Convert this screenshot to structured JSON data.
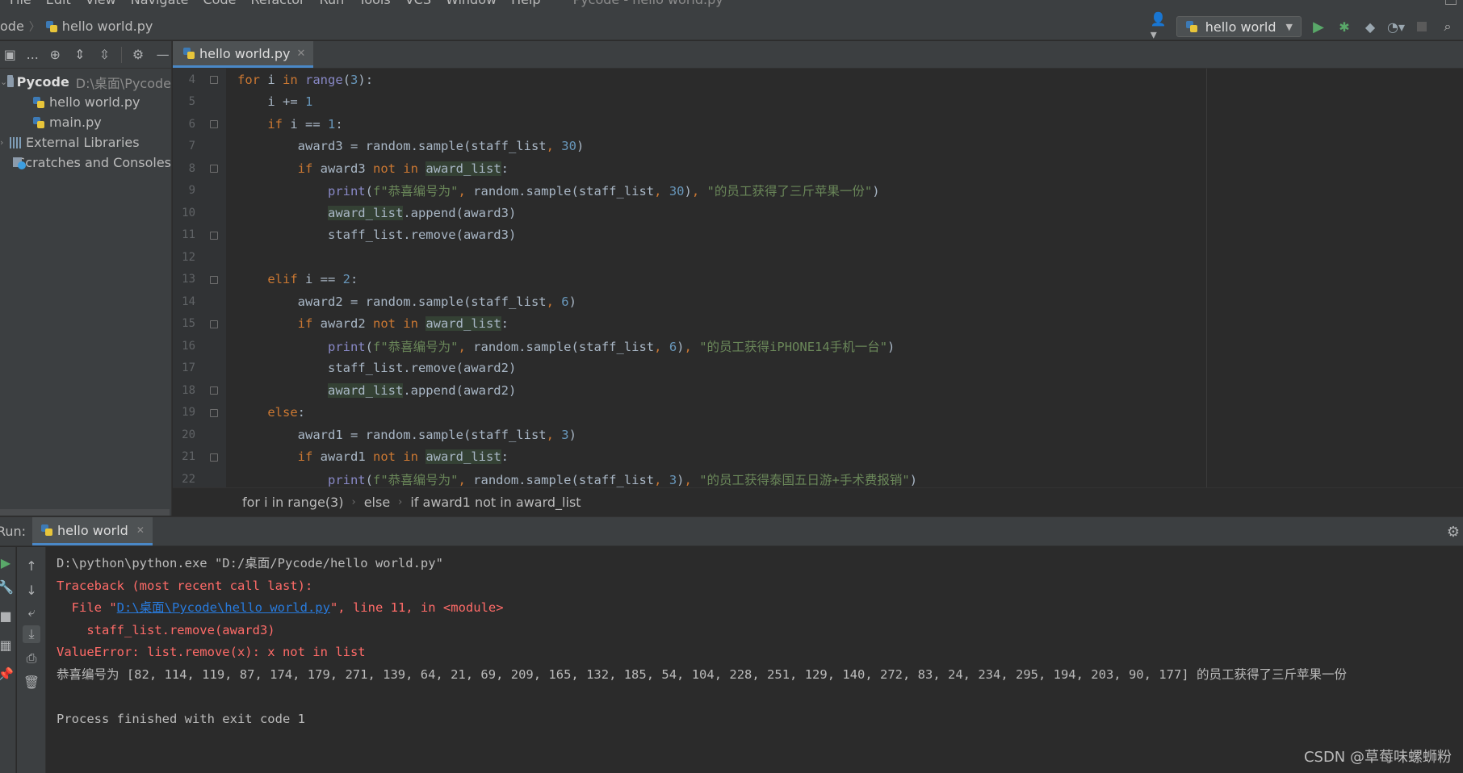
{
  "menubar": {
    "items": [
      "File",
      "Edit",
      "View",
      "Navigate",
      "Code",
      "Refactor",
      "Run",
      "Tools",
      "VCS",
      "Window",
      "Help"
    ],
    "title": "Pycode - hello world.py"
  },
  "navbar": {
    "crumbs": [
      "ode",
      "hello world.py"
    ],
    "run_config": "hello world"
  },
  "project": {
    "toolbar_label": "...",
    "root_name": "Pycode",
    "root_path": "D:\\桌面\\Pycode",
    "files": [
      "hello world.py",
      "main.py"
    ],
    "external_libraries": "External Libraries",
    "scratches": "Scratches and Consoles"
  },
  "editor": {
    "tab_label": "hello world.py",
    "line_numbers": [
      "4",
      "5",
      "6",
      "7",
      "8",
      "9",
      "10",
      "11",
      "12",
      "13",
      "14",
      "15",
      "16",
      "17",
      "18",
      "19",
      "20",
      "21",
      "22"
    ],
    "breadcrumb": [
      "for i in range(3)",
      "else",
      "if award1 not in award_list"
    ]
  },
  "run": {
    "label": "Run:",
    "tab_label": "hello world",
    "console": {
      "cmd": "D:\\python\\python.exe \"D:/桌面/Pycode/hello world.py\"",
      "traceback": "Traceback (most recent call last):",
      "file_prefix": "  File \"",
      "file_link": "D:\\桌面\\Pycode\\hello world.py",
      "file_suffix": "\", line 11, in <module>",
      "code_line": "    staff_list.remove(award3)",
      "error": "ValueError: list.remove(x): x not in list",
      "output": "恭喜编号为 [82, 114, 119, 87, 174, 179, 271, 139, 64, 21, 69, 209, 165, 132, 185, 54, 104, 228, 251, 129, 140, 272, 83, 24, 234, 295, 194, 203, 90, 177] 的员工获得了三斤苹果一份",
      "finished": "Process finished with exit code 1"
    }
  },
  "watermark": "CSDN @草莓味螺蛳粉",
  "colors": {
    "keyword": "#cc7832",
    "number": "#6897bb",
    "string": "#6a8759",
    "error": "#ff6b68",
    "link": "#287bde",
    "accent": "#4a88c7"
  }
}
